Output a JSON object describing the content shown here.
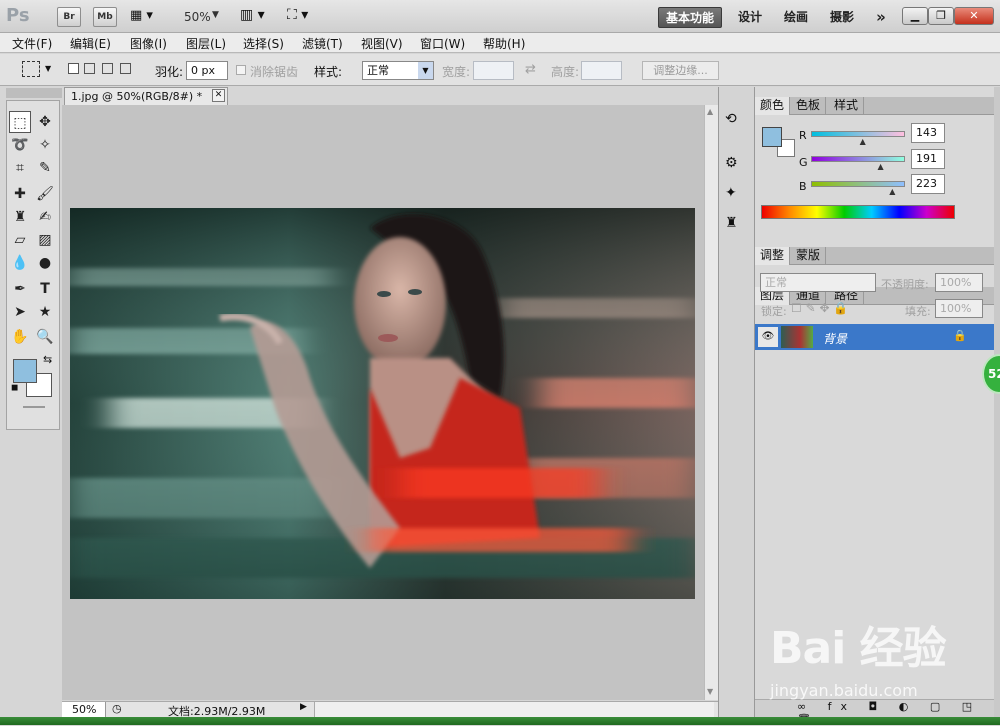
{
  "appbar": {
    "logo": "Ps",
    "br": "Br",
    "mb": "Mb",
    "zoom": "50%",
    "workspaces": [
      "基本功能",
      "设计",
      "绘画",
      "摄影"
    ],
    "more": "»"
  },
  "menu": [
    "文件(F)",
    "编辑(E)",
    "图像(I)",
    "图层(L)",
    "选择(S)",
    "滤镜(T)",
    "视图(V)",
    "窗口(W)",
    "帮助(H)"
  ],
  "options": {
    "feather_label": "羽化:",
    "feather_value": "0 px",
    "antialias": "消除锯齿",
    "style_label": "样式:",
    "style_value": "正常",
    "width_label": "宽度:",
    "height_label": "高度:",
    "refine": "调整边缘..."
  },
  "document": {
    "tab_title": "1.jpg @ 50%(RGB/8#) *",
    "zoom": "50%",
    "doc_size": "文档:2.93M/2.93M"
  },
  "color_panel": {
    "tabs": [
      "颜色",
      "色板",
      "样式"
    ],
    "r_label": "R",
    "g_label": "G",
    "b_label": "B",
    "r": "143",
    "g": "191",
    "b": "223",
    "fg_color": "#8fbfdf",
    "r_frac": 0.56,
    "g_frac": 0.75,
    "b_frac": 0.875
  },
  "adjust_panel": {
    "tabs": [
      "调整",
      "蒙版"
    ]
  },
  "layers_panel": {
    "tabs": [
      "图层",
      "通道",
      "路径"
    ],
    "blend": "正常",
    "opacity_label": "不透明度:",
    "opacity": "100%",
    "lock_label": "锁定:",
    "fill_label": "填充:",
    "fill": "100%",
    "layer_name": "背景"
  },
  "watermark": {
    "brand": "Bai 经验",
    "url": "jingyan.baidu.com"
  },
  "badge": "52"
}
